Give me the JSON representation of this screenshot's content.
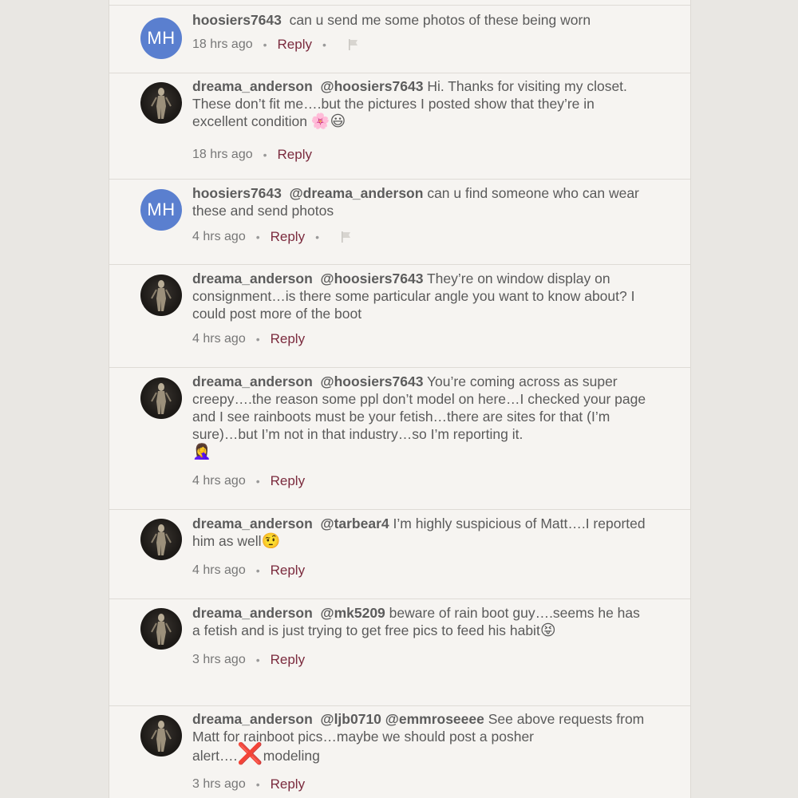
{
  "comments": [
    {
      "user": "hoosiers7643",
      "avatar": "MH",
      "mention": "",
      "text": "can u send me some photos of these being worn",
      "time": "18 hrs ago",
      "reply": "Reply"
    },
    {
      "user": "dreama_anderson",
      "mention": "@hoosiers7643",
      "text": "Hi.  Thanks for visiting my closet.  These don’t fit me….but the pictures I posted show that they’re in excellent condition",
      "emoji": "🌸😃",
      "time": "18 hrs ago",
      "reply": "Reply"
    },
    {
      "user": "hoosiers7643",
      "avatar": "MH",
      "mention": "@dreama_anderson",
      "text": "can u find someone who can wear these and send photos",
      "time": "4 hrs ago",
      "reply": "Reply"
    },
    {
      "user": "dreama_anderson",
      "mention": "@hoosiers7643",
      "text": "They’re on window display on consignment…is there some particular angle you want to know about?  I could post more of the boot",
      "time": "4 hrs ago",
      "reply": "Reply"
    },
    {
      "user": "dreama_anderson",
      "mention": "@hoosiers7643",
      "text": "You’re coming across as super creepy….the reason some ppl don’t model on here…I checked your page and I see rainboots must be your fetish…there are sites for that (I’m sure)…but I’m not in that industry…so I’m reporting it.",
      "emoji": "🤦‍♀️",
      "time": "4 hrs ago",
      "reply": "Reply"
    },
    {
      "user": "dreama_anderson",
      "mention": "@tarbear4",
      "text": "I’m highly suspicious of Matt….I reported him as well",
      "emoji": "🤨",
      "time": "4 hrs ago",
      "reply": "Reply"
    },
    {
      "user": "dreama_anderson",
      "mention": "@mk5209",
      "text": "beware of rain boot guy….seems he has a fetish and is just trying to get free pics to feed his habit",
      "emoji": "😝",
      "time": "3 hrs ago",
      "reply": "Reply"
    },
    {
      "user": "dreama_anderson",
      "mention": "@ljb0710 @emmroseeee",
      "text": "See above requests from Matt for rainboot pics…maybe we should post a posher alert….",
      "emoji": "❌",
      "text_after": "modeling",
      "time": "3 hrs ago",
      "reply": "Reply"
    }
  ],
  "colors": {
    "reply_link": "#7b2b3e",
    "avatar_initials_bg": "#5a7fcf",
    "panel_bg": "#f6f4f1"
  }
}
